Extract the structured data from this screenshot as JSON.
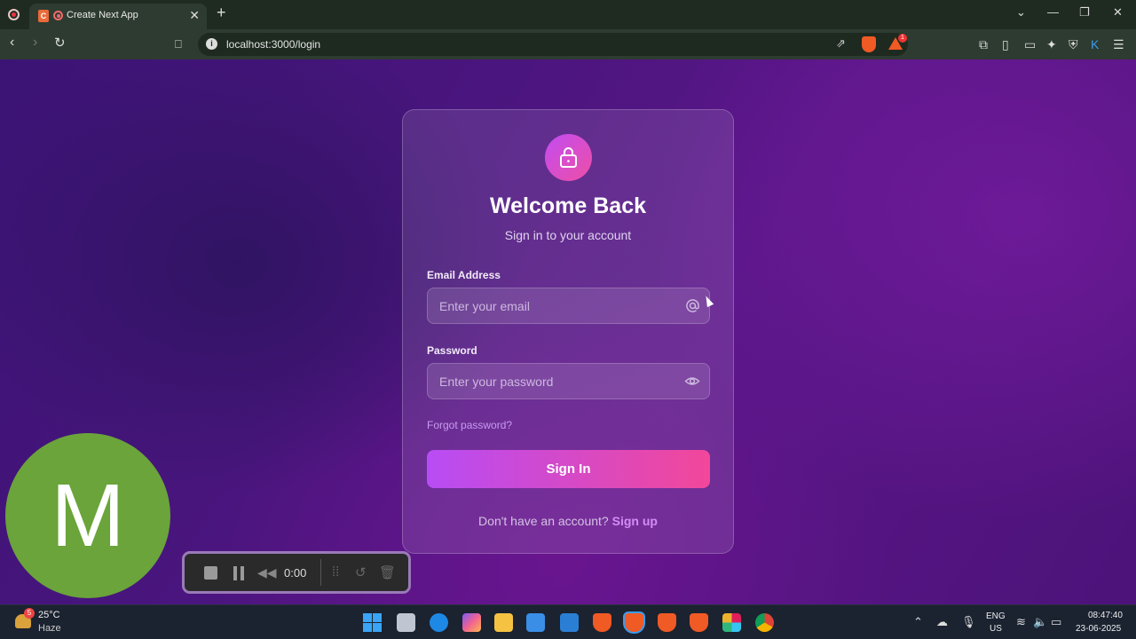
{
  "browser": {
    "tab_title": "Create Next App",
    "tab_favicon_letter": "C",
    "url": "localhost:3000/login",
    "notification_count": "1"
  },
  "login": {
    "title": "Welcome Back",
    "subtitle": "Sign in to your account",
    "email_label": "Email Address",
    "email_placeholder": "Enter your email",
    "password_label": "Password",
    "password_placeholder": "Enter your password",
    "forgot_password": "Forgot password?",
    "submit_label": "Sign In",
    "signup_prompt": "Don't have an account?",
    "signup_link": "Sign up"
  },
  "overlay": {
    "avatar_letter": "M",
    "recorder_time": "0:00"
  },
  "taskbar": {
    "weather_badge": "5",
    "weather_temp": "25°C",
    "weather_desc": "Haze",
    "language": "ENG",
    "region": "US",
    "time": "08:47:40",
    "date": "23-06-2025"
  },
  "colors": {
    "card_accent_start": "#c24cf2",
    "card_accent_end": "#f2479a",
    "link": "#c79cf0",
    "avatar": "#6aa43a"
  }
}
